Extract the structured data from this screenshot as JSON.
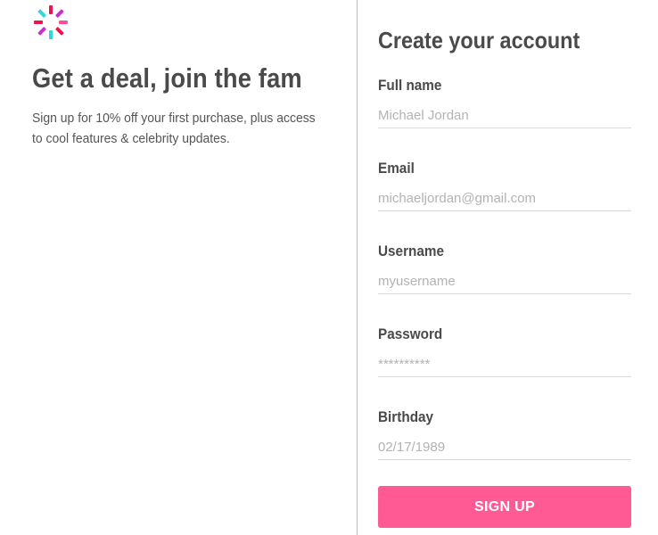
{
  "branding": {
    "logo_icon": "sunburst-logo-icon",
    "colors": {
      "pink": "#ff4f9a",
      "magenta": "#d12ad6",
      "cyan": "#33d6d9",
      "crimson": "#e8154f"
    }
  },
  "promo": {
    "headline": "Get a deal, join the fam",
    "subline": "Sign up for 10% off your first purchase, plus access to cool features & celebrity updates."
  },
  "form": {
    "title": "Create your account",
    "fields": [
      {
        "label": "Full name",
        "placeholder": "Michael Jordan",
        "type": "text"
      },
      {
        "label": "Email",
        "placeholder": "michaeljordan@gmail.com",
        "type": "email"
      },
      {
        "label": "Username",
        "placeholder": "myusername",
        "type": "text"
      },
      {
        "label": "Password",
        "placeholder": "**********",
        "type": "text"
      },
      {
        "label": "Birthday",
        "placeholder": "02/17/1989",
        "type": "text"
      }
    ],
    "submit_label": "SIGN UP",
    "accent_color": "#ff5a93"
  }
}
